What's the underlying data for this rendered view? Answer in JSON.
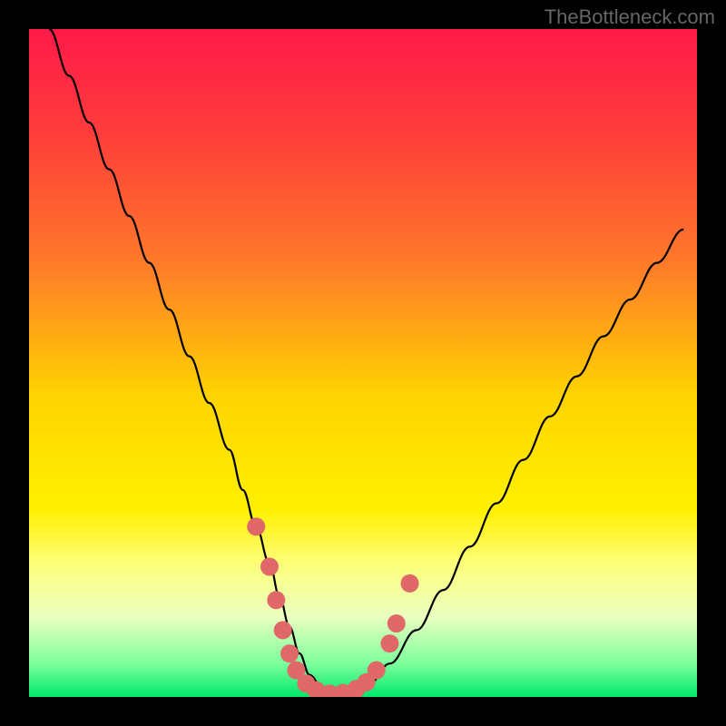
{
  "watermark": "TheBottleneck.com",
  "chart_data": {
    "type": "line",
    "title": "",
    "xlabel": "",
    "ylabel": "",
    "xlim": [
      0,
      100
    ],
    "ylim": [
      0,
      100
    ],
    "gradient_stops": [
      {
        "offset": 0,
        "color": "#ff1a49"
      },
      {
        "offset": 15,
        "color": "#ff3b3b"
      },
      {
        "offset": 35,
        "color": "#ff7a2a"
      },
      {
        "offset": 55,
        "color": "#ffd400"
      },
      {
        "offset": 72,
        "color": "#fff000"
      },
      {
        "offset": 80,
        "color": "#fdff7a"
      },
      {
        "offset": 88,
        "color": "#eaffc0"
      },
      {
        "offset": 95,
        "color": "#7cff9c"
      },
      {
        "offset": 100,
        "color": "#00e86b"
      }
    ],
    "series": [
      {
        "name": "curve",
        "color": "#000000",
        "x": [
          3,
          6,
          9,
          12,
          15,
          18,
          21,
          24,
          27,
          30,
          32,
          34,
          36,
          37.5,
          39,
          40.5,
          42,
          44,
          46,
          48,
          51,
          54,
          58,
          62,
          66,
          70,
          74,
          78,
          82,
          86,
          90,
          94,
          98
        ],
        "y": [
          100,
          93,
          86,
          79,
          72,
          65,
          58,
          51,
          44,
          37,
          31,
          25.5,
          20,
          15,
          10.5,
          6.5,
          3.3,
          1.2,
          0.4,
          0.6,
          2,
          5,
          10,
          16,
          22.5,
          29,
          35.5,
          42,
          48,
          54,
          59.5,
          65,
          70
        ]
      }
    ],
    "markers": {
      "name": "highlight-points",
      "color": "#e06868",
      "radius": 10,
      "points": [
        {
          "x": 34.0,
          "y": 25.5
        },
        {
          "x": 36.0,
          "y": 19.5
        },
        {
          "x": 37.0,
          "y": 14.5
        },
        {
          "x": 38.0,
          "y": 10.0
        },
        {
          "x": 39.0,
          "y": 6.5
        },
        {
          "x": 40.0,
          "y": 4.0
        },
        {
          "x": 41.5,
          "y": 2.0
        },
        {
          "x": 43.0,
          "y": 1.0
        },
        {
          "x": 45.0,
          "y": 0.5
        },
        {
          "x": 47.0,
          "y": 0.6
        },
        {
          "x": 49.0,
          "y": 1.2
        },
        {
          "x": 50.5,
          "y": 2.2
        },
        {
          "x": 52.0,
          "y": 4.0
        },
        {
          "x": 54.0,
          "y": 8.0
        },
        {
          "x": 55.0,
          "y": 11.0
        },
        {
          "x": 57.0,
          "y": 17.0
        }
      ]
    }
  }
}
